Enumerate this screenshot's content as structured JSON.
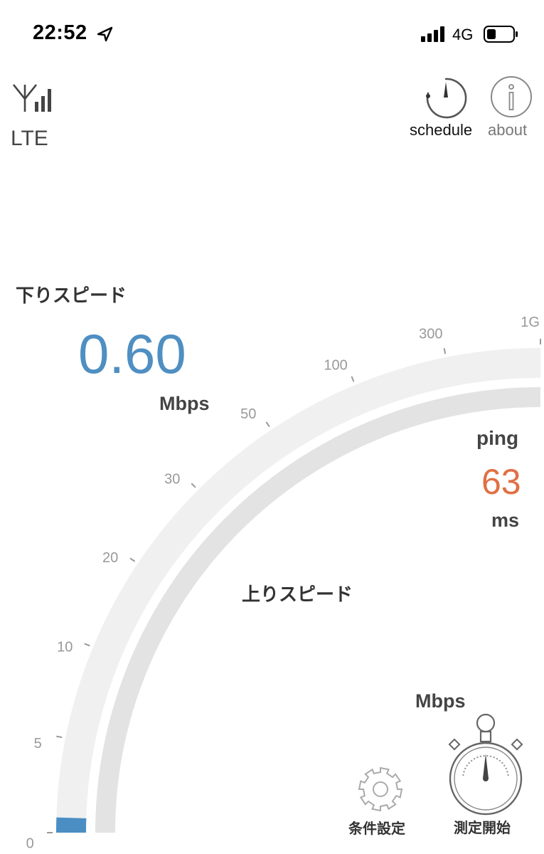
{
  "status_bar": {
    "time": "22:52",
    "network": "4G"
  },
  "connection": {
    "type": "LTE"
  },
  "top_buttons": {
    "schedule": "schedule",
    "about": "about"
  },
  "download": {
    "label": "下りスピード",
    "value": "0.60",
    "unit": "Mbps"
  },
  "ping": {
    "label": "ping",
    "value": "63",
    "unit": "ms"
  },
  "upload": {
    "label": "上りスピード",
    "unit": "Mbps"
  },
  "bottom_buttons": {
    "settings": "条件設定",
    "start": "測定開始"
  },
  "gauge": {
    "ticks": [
      "0",
      "5",
      "10",
      "20",
      "30",
      "50",
      "100",
      "300",
      "1G"
    ],
    "current_download": 0.6,
    "colors": {
      "track_outer": "#f0f0f0",
      "track_inner": "#e3e3e3",
      "fill": "#4a8ec4"
    }
  },
  "colors": {
    "download_value": "#4f8fc2",
    "ping_value": "#e07043"
  }
}
